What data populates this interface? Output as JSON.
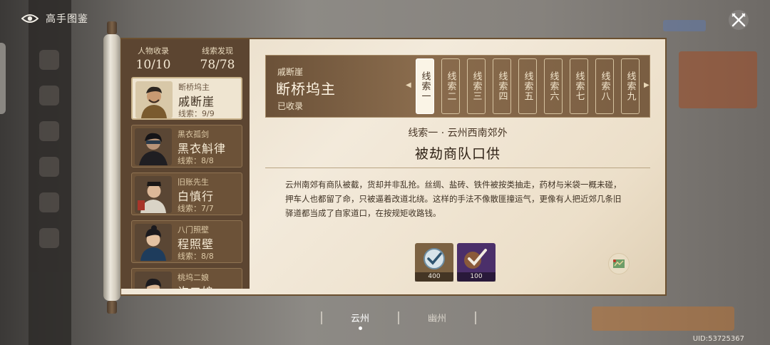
{
  "page": {
    "title": "高手图鉴",
    "uid": "UID:53725367"
  },
  "stats": {
    "collected_label": "人物收录",
    "collected_value": "10/10",
    "clues_label": "线索发现",
    "clues_value": "78/78"
  },
  "characters": [
    {
      "sub": "断桥坞主",
      "name": "戚断崖",
      "clues": "线索：9/9",
      "active": true
    },
    {
      "sub": "黑衣孤剑",
      "name": "黑衣斛律",
      "clues": "线索：8/8"
    },
    {
      "sub": "旧账先生",
      "name": "白慎行",
      "clues": "线索：7/7"
    },
    {
      "sub": "八门照壁",
      "name": "程照壁",
      "clues": "线索：8/8"
    },
    {
      "sub": "桃坞二娘",
      "name": "许二娘",
      "clues": ""
    }
  ],
  "header": {
    "subtitle": "戚断崖",
    "name": "断桥坞主",
    "status": "已收录"
  },
  "tabs": [
    "线索一",
    "线索二",
    "线索三",
    "线索四",
    "线索五",
    "线索六",
    "线索七",
    "线索八",
    "线索九"
  ],
  "clue": {
    "title": "线索一 · 云州西南郊外",
    "heading": "被劫商队口供",
    "text": "云州南郊有商队被截，货却并非乱抢。丝绸、盐砖、铁件被按类抽走，药材与米袋一概未碰，押车人也都留了命，只被逼着改道北绕。这样的手法不像散匪撞运气，更像有人把近郊几条旧驿道都当成了自家道口，在按规矩收路钱。"
  },
  "items": [
    {
      "count": "400",
      "icon": "check-badge-icon"
    },
    {
      "count": "100",
      "icon": "check-scroll-icon"
    }
  ],
  "regions": [
    {
      "label": "云州",
      "active": true
    },
    {
      "label": "幽州",
      "active": false
    }
  ],
  "colors": {
    "panel": "#efe4d0",
    "sidebar": "#5c4531",
    "accent": "#6b5030"
  }
}
